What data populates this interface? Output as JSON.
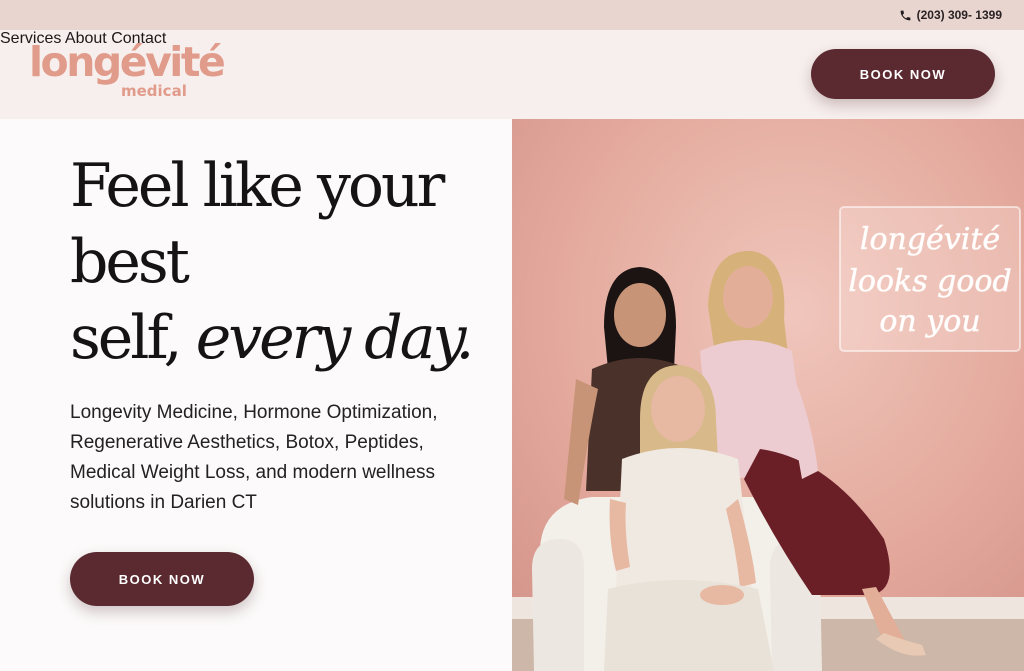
{
  "topbar": {
    "phone": "(203) 309- 1399",
    "phone_icon": "phone-icon"
  },
  "header": {
    "logo_main": "longévité",
    "logo_sub": "medical",
    "nav": [
      {
        "label": "Services"
      },
      {
        "label": "About"
      },
      {
        "label": "Contact"
      }
    ],
    "cta": "BOOK NOW"
  },
  "hero": {
    "headline_line1": "Feel like your",
    "headline_line2": "best",
    "headline_line3_plain": "self,",
    "headline_line3_italic": "every day.",
    "subtext": "Longevity Medicine, Hormone Optimization, Regenerative Aesthetics, Botox, Peptides, Medical Weight Loss, and modern wellness solutions in Darien CT",
    "cta": "BOOK NOW"
  },
  "photo": {
    "neon_line1": "longévité",
    "neon_line2": "looks good",
    "neon_line3": "on you"
  },
  "colors": {
    "topbar": "#e8d5d0",
    "header": "#f7efed",
    "logo": "#e19b8b",
    "button": "#5b2a31",
    "wall": "#e3aa9e"
  }
}
